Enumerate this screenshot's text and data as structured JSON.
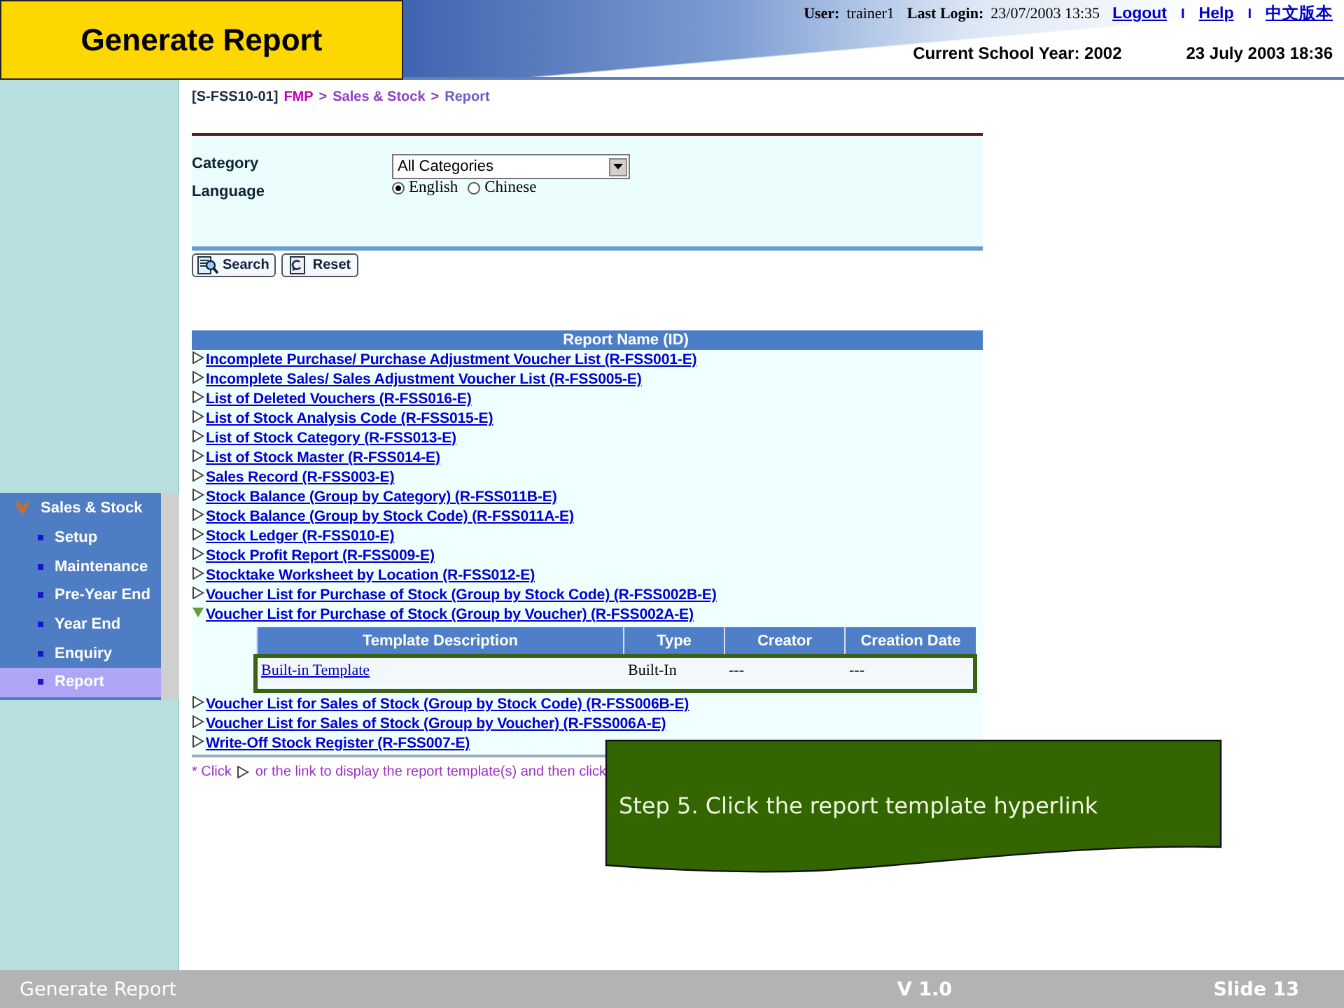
{
  "slide": {
    "title": "Generate Report",
    "footer_left": "Generate Report",
    "version": "V 1.0",
    "slide_number": "Slide 13"
  },
  "header": {
    "user_label": "User:",
    "user": "trainer1",
    "last_login_label": "Last Login:",
    "last_login": "23/07/2003 13:35",
    "links": [
      "Logout",
      "Help",
      "中文版本"
    ],
    "separators": [
      "I",
      "I"
    ],
    "school_year": "Current School Year: 2002",
    "datetime": "23 July 2003 18:36"
  },
  "sidebar": {
    "menu": {
      "label": "Sales & Stock",
      "expanded": true,
      "items": [
        {
          "label": "Setup",
          "selected": false
        },
        {
          "label": "Maintenance",
          "selected": false
        },
        {
          "label": "Pre-Year End",
          "selected": false
        },
        {
          "label": "Year End",
          "selected": false
        },
        {
          "label": "Enquiry",
          "selected": false
        },
        {
          "label": "Report",
          "selected": true
        }
      ]
    }
  },
  "breadcrumb": {
    "screen_id": "[S-FSS10-01]",
    "path": [
      "FMP",
      "Sales & Stock",
      "Report"
    ],
    "separators": [
      ">",
      ">"
    ]
  },
  "form": {
    "fields": [
      {
        "kind": "select",
        "label": "Category",
        "value": "All Categories"
      },
      {
        "kind": "radio",
        "label": "Language",
        "options": [
          {
            "label": "English",
            "selected": true
          },
          {
            "label": "Chinese",
            "selected": false
          }
        ]
      }
    ],
    "buttons": [
      {
        "kind": "search",
        "label": "Search"
      },
      {
        "kind": "reset",
        "label": "Reset"
      }
    ]
  },
  "reports": {
    "header": "Report Name (ID)",
    "items": [
      {
        "label": "Incomplete Purchase/ Purchase Adjustment Voucher List (R-FSS001-E)",
        "expanded": false
      },
      {
        "label": "Incomplete Sales/ Sales Adjustment Voucher List (R-FSS005-E)",
        "expanded": false
      },
      {
        "label": "List of Deleted Vouchers (R-FSS016-E)",
        "expanded": false
      },
      {
        "label": "List of Stock Analysis Code (R-FSS015-E)",
        "expanded": false
      },
      {
        "label": "List of Stock Category (R-FSS013-E)",
        "expanded": false
      },
      {
        "label": "List of Stock Master (R-FSS014-E)",
        "expanded": false
      },
      {
        "label": "Sales Record (R-FSS003-E)",
        "expanded": false
      },
      {
        "label": "Stock Balance (Group by Category) (R-FSS011B-E)",
        "expanded": false
      },
      {
        "label": "Stock Balance (Group by Stock Code) (R-FSS011A-E)",
        "expanded": false
      },
      {
        "label": "Stock Ledger (R-FSS010-E)",
        "expanded": false
      },
      {
        "label": "Stock Profit Report (R-FSS009-E)",
        "expanded": false
      },
      {
        "label": "Stocktake Worksheet by Location (R-FSS012-E)",
        "expanded": false
      },
      {
        "label": "Voucher List for Purchase of Stock (Group by Stock Code) (R-FSS002B-E)",
        "expanded": false
      },
      {
        "label": "Voucher List for Purchase of Stock (Group by Voucher) (R-FSS002A-E)",
        "expanded": true,
        "templates": {
          "columns": [
            "Template Description",
            "Type",
            "Creator",
            "Creation Date"
          ],
          "rows": [
            {
              "cells": [
                "Built-in Template",
                "Built-In",
                "---",
                "---"
              ],
              "highlighted": true
            }
          ]
        }
      },
      {
        "label": "Voucher List for Sales of Stock (Group by Stock Code) (R-FSS006B-E)",
        "expanded": false
      },
      {
        "label": "Voucher List for Sales of Stock (Group by Voucher) (R-FSS006A-E)",
        "expanded": false
      },
      {
        "label": "Write-Off Stock Register (R-FSS007-E)",
        "expanded": false
      }
    ]
  },
  "note": {
    "before": "* Click",
    "after": "or the link to display the report template(s) and then click"
  },
  "callout": {
    "text": "Step 5. Click the report template hyperlink"
  }
}
